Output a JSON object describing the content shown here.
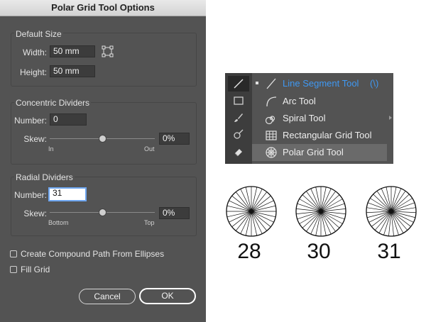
{
  "dialog": {
    "title": "Polar Grid Tool Options",
    "default_size": {
      "title": "Default Size",
      "width_label": "Width:",
      "width_value": "50 mm",
      "height_label": "Height:",
      "height_value": "50 mm"
    },
    "concentric": {
      "title": "Concentric Dividers",
      "number_label": "Number:",
      "number_value": "0",
      "skew_label": "Skew:",
      "skew_value": "0%",
      "min_label": "In",
      "max_label": "Out",
      "skew_position": 0.5
    },
    "radial": {
      "title": "Radial Dividers",
      "number_label": "Number:",
      "number_value": "31",
      "skew_label": "Skew:",
      "skew_value": "0%",
      "min_label": "Bottom",
      "max_label": "Top",
      "skew_position": 0.5
    },
    "options": [
      {
        "label": "Create Compound Path From Ellipses",
        "checked": false
      },
      {
        "label": "Fill Grid",
        "checked": false
      }
    ],
    "cancel_label": "Cancel",
    "ok_label": "OK"
  },
  "tool_flyout": {
    "items": [
      {
        "label": "Line Segment Tool",
        "shortcut": "(\\)",
        "icon": "line-segment-icon",
        "active": true
      },
      {
        "label": "Arc Tool",
        "icon": "arc-icon"
      },
      {
        "label": "Spiral Tool",
        "icon": "spiral-icon"
      },
      {
        "label": "Rectangular Grid Tool",
        "icon": "rectangular-grid-icon"
      },
      {
        "label": "Polar Grid Tool",
        "icon": "polar-grid-icon",
        "highlighted": true
      }
    ],
    "accent_color": "#3f98f2",
    "toolbar_icons": [
      "line-icon",
      "rectangle-icon",
      "paintbrush-icon",
      "shaper-icon",
      "eraser-icon"
    ]
  },
  "examples": [
    {
      "label": "28",
      "dividers": 28
    },
    {
      "label": "30",
      "dividers": 30
    },
    {
      "label": "31",
      "dividers": 31
    }
  ]
}
